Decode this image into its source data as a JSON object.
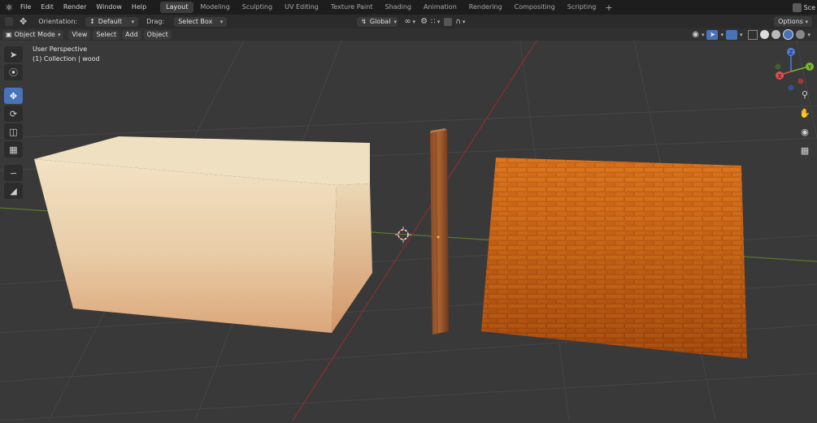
{
  "menus": [
    "File",
    "Edit",
    "Render",
    "Window",
    "Help"
  ],
  "workspaces": [
    "Layout",
    "Modeling",
    "Sculpting",
    "UV Editing",
    "Texture Paint",
    "Shading",
    "Animation",
    "Rendering",
    "Compositing",
    "Scripting"
  ],
  "scene_label": "Sce",
  "toolbar": {
    "orientation_label": "Orientation:",
    "orientation_value": "Default",
    "drag_label": "Drag:",
    "drag_value": "Select Box",
    "transform_value": "Global",
    "options_label": "Options"
  },
  "header": {
    "mode": "Object Mode",
    "view": "View",
    "select": "Select",
    "add": "Add",
    "object": "Object"
  },
  "viewport": {
    "perspective": "User Perspective",
    "collection": "(1) Collection | wood"
  },
  "gizmo": {
    "z": "Z",
    "y": "Y",
    "x": "X"
  },
  "colors": {
    "active_tab": "#3d3d3d",
    "tool_active": "#4a72b8",
    "x_axis": "#e05050",
    "y_axis": "#7ab830",
    "z_axis": "#4f7de0"
  }
}
